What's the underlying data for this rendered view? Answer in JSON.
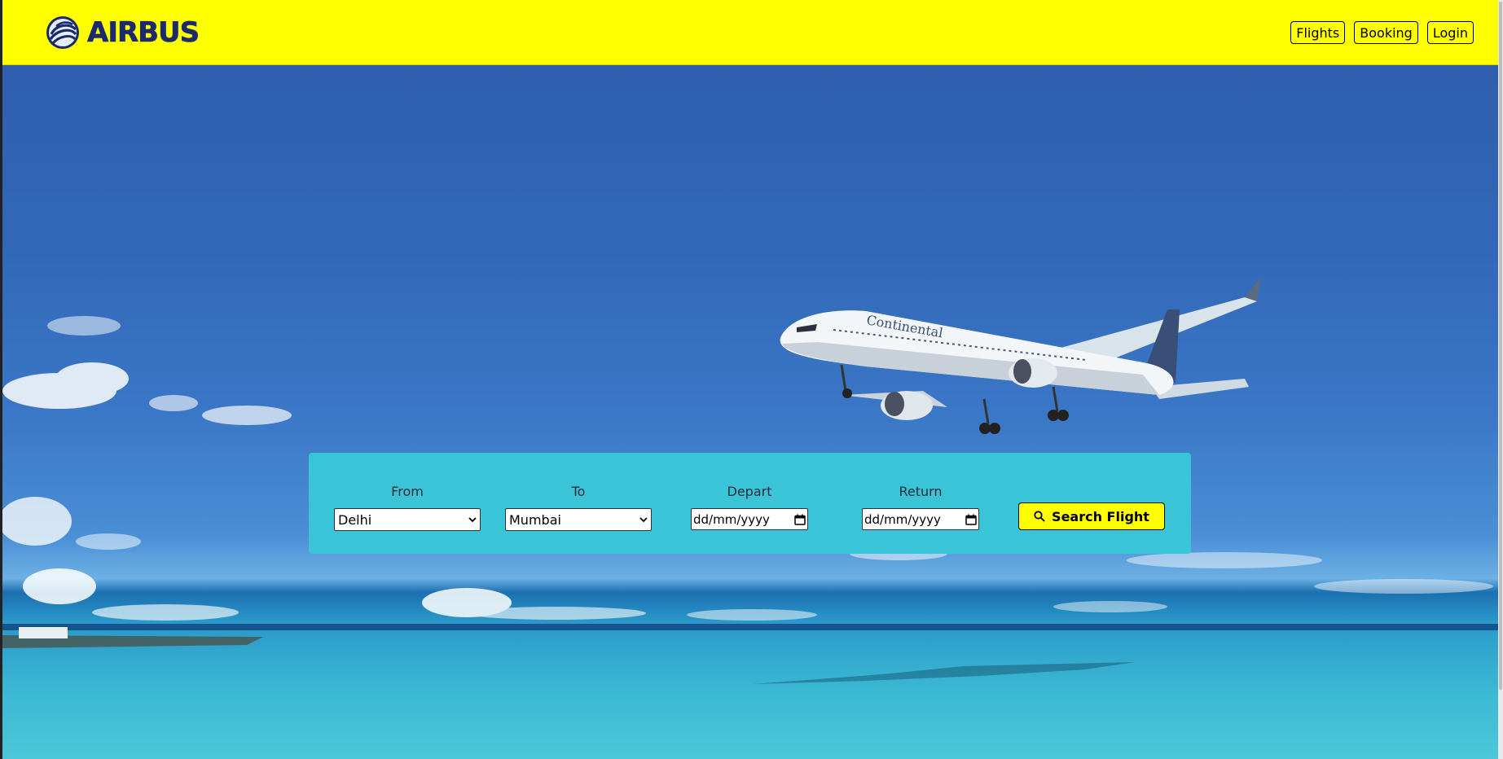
{
  "brand": {
    "name": "AIRBUS",
    "logo_icon": "airbus-swirl-logo",
    "header_color": "#ffff00",
    "text_color": "#1a2a6c"
  },
  "nav": {
    "items": [
      {
        "label": "Flights"
      },
      {
        "label": "Booking"
      },
      {
        "label": "Login"
      }
    ]
  },
  "hero": {
    "image": "airliner-over-tropical-sea",
    "airliner_livery_text": "Continental"
  },
  "search": {
    "panel_color": "#3ac4d8",
    "from": {
      "label": "From",
      "value": "Delhi"
    },
    "to": {
      "label": "To",
      "value": "Mumbai"
    },
    "depart": {
      "label": "Depart",
      "placeholder": "dd/mm/yyyy"
    },
    "return": {
      "label": "Return",
      "placeholder": "dd/mm/yyyy"
    },
    "button": {
      "label": "Search Flight",
      "icon": "search-icon",
      "color": "#ffff00"
    }
  }
}
